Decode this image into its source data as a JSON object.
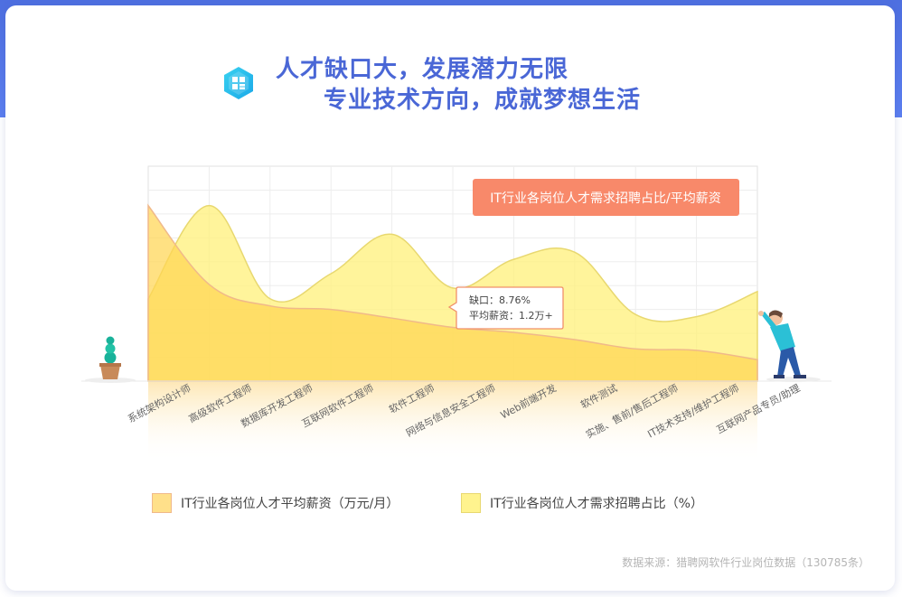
{
  "header": {
    "title_line1": "人才缺口大，发展潜力无限",
    "title_line2": "专业技术方向，成就梦想生活"
  },
  "chart_data": {
    "type": "area",
    "title": "IT行业各岗位人才需求招聘占比/平均薪资",
    "categories": [
      "系统架构设计师",
      "高级软件工程师",
      "数据库开发工程师",
      "互联网软件工程师",
      "软件工程师",
      "网络与信息安全工程师",
      "Web前端开发",
      "软件测试",
      "实施、售前/售后工程师",
      "IT技术支持/维护工程师",
      "互联网产品专员/助理"
    ],
    "series": [
      {
        "name": "IT行业各岗位人才平均薪资（万元/月）",
        "values": [
          2.45,
          1.35,
          1.05,
          1.0,
          0.88,
          0.75,
          0.68,
          0.58,
          0.45,
          0.43,
          0.3
        ]
      },
      {
        "name": "IT行业各岗位人才需求招聘占比（%）",
        "values": [
          1.15,
          2.45,
          1.15,
          1.5,
          2.05,
          1.3,
          1.7,
          1.8,
          0.93,
          0.9,
          1.25
        ]
      }
    ],
    "ylim": [
      0,
      3.0
    ],
    "grid": true,
    "legend_position": "bottom",
    "tooltip": {
      "line1": "缺口：8.76%",
      "line2": "平均薪资：1.2万+"
    },
    "colors": {
      "salary_fill": "#ffd653",
      "salary_stroke": "#f0b98a",
      "demand_fill": "#fff07a",
      "demand_stroke": "#e8d870",
      "badge": "#f8896a",
      "tooltip_border": "#f0906a"
    }
  },
  "legend": {
    "salary_label": "IT行业各岗位人才平均薪资（万元/月）",
    "demand_label": "IT行业各岗位人才需求招聘占比（%）"
  },
  "footer": {
    "source_note": "数据来源：猎聘网软件行业岗位数据（130785条）"
  }
}
